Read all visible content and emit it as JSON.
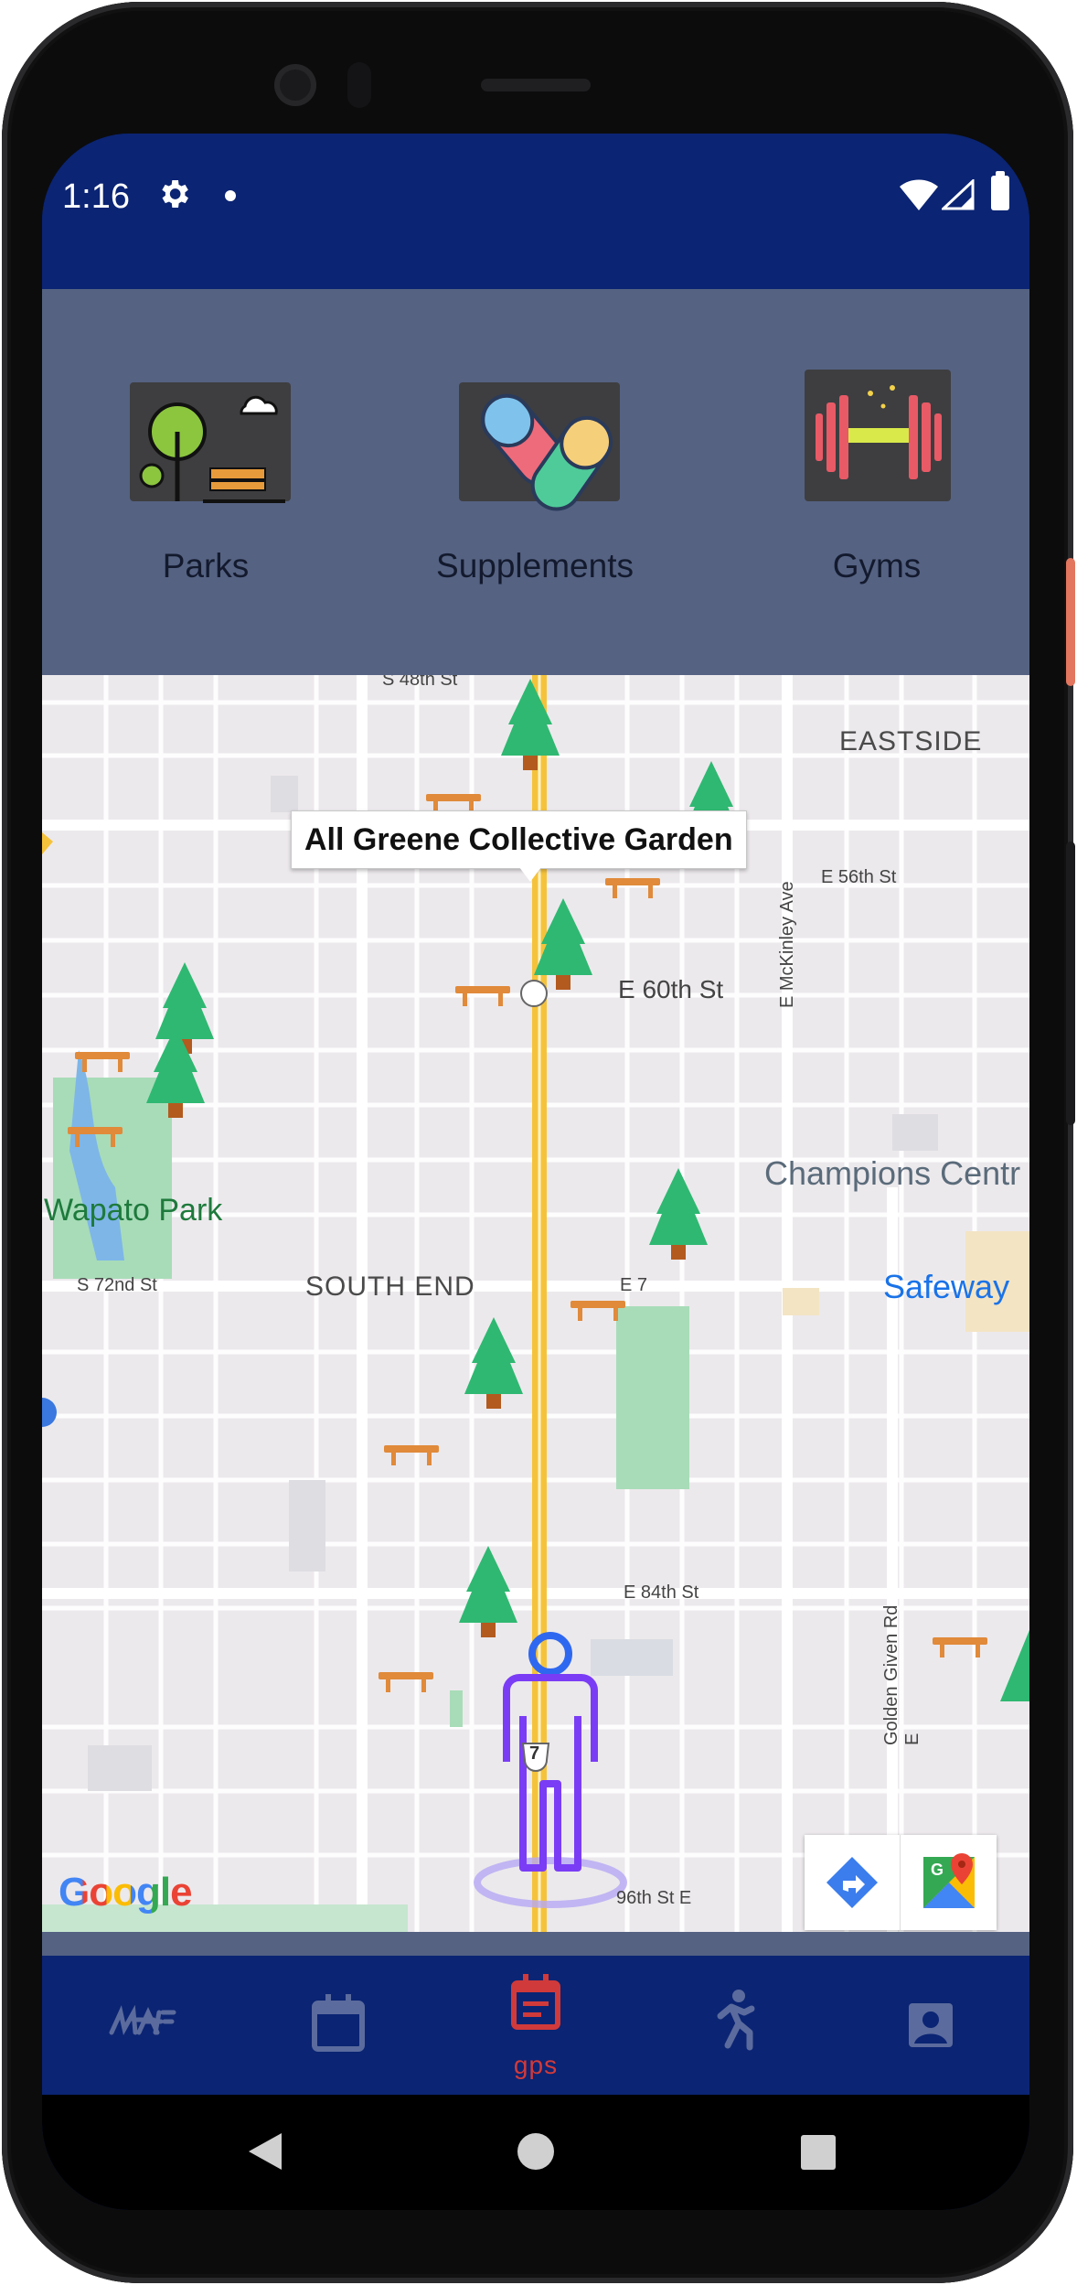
{
  "status_bar": {
    "time": "1:16",
    "icons": [
      "gear-icon",
      "notification-dot-icon",
      "wifi-icon",
      "signal-icon",
      "battery-icon"
    ]
  },
  "categories": [
    {
      "label": "Parks",
      "icon": "park-bench-tree-icon"
    },
    {
      "label": "Supplements",
      "icon": "pills-icon"
    },
    {
      "label": "Gyms",
      "icon": "dumbbell-icon"
    }
  ],
  "map": {
    "selected_place": "All Greene Collective Garden",
    "area_labels": [
      "EASTSIDE",
      "SOUTH END"
    ],
    "places": [
      "Wapato Park",
      "Champions Centr",
      "Safeway"
    ],
    "streets": [
      "S 48th St",
      "E 56th St",
      "E 60th St",
      "S 72nd St",
      "E 7",
      "E 84th St",
      "96th St E"
    ],
    "vertical_streets": [
      "E McKinley Ave",
      "Golden Given Rd E"
    ],
    "route_shield": "7",
    "attribution": "Google",
    "buttons": [
      {
        "name": "directions",
        "icon": "directions-icon"
      },
      {
        "name": "open-maps",
        "icon": "google-maps-icon"
      }
    ],
    "colors": {
      "park_green": "#a8dcb8",
      "road_yellow": "#f5c33b",
      "accent_blue": "#1a73e8"
    }
  },
  "bottom_nav": {
    "items": [
      {
        "label": "",
        "icon": "signature-logo-icon"
      },
      {
        "label": "",
        "icon": "calendar-icon"
      },
      {
        "label": "gps",
        "icon": "event-note-icon",
        "active": true
      },
      {
        "label": "",
        "icon": "running-icon"
      },
      {
        "label": "",
        "icon": "account-box-icon"
      }
    ],
    "active_color": "#d13a3a",
    "inactive_color": "#5b6b9d"
  },
  "system_nav": [
    "back-icon",
    "home-icon",
    "recents-icon"
  ]
}
